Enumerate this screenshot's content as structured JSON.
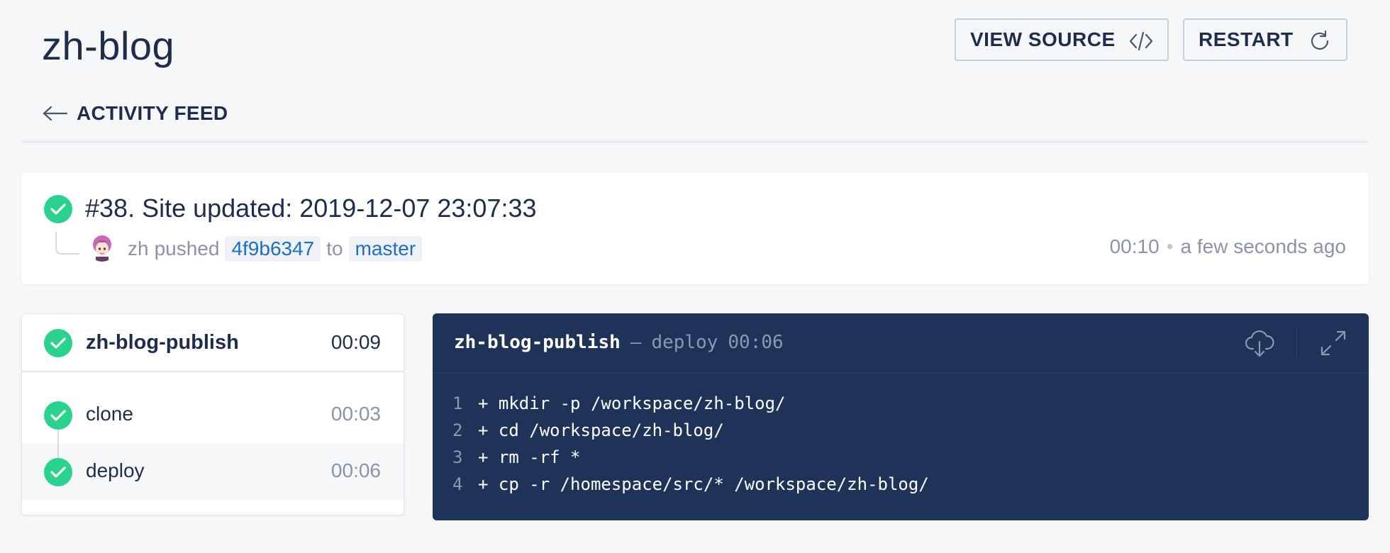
{
  "header": {
    "title": "zh-blog",
    "view_source_label": "VIEW SOURCE",
    "restart_label": "RESTART",
    "back_label": "ACTIVITY FEED"
  },
  "build": {
    "title": "#38. Site updated: 2019-12-07 23:07:33",
    "author": "zh",
    "pushed_text": "pushed",
    "commit": "4f9b6347",
    "to_text": "to",
    "branch": "master",
    "duration": "00:10",
    "separator": "•",
    "time_ago": "a few seconds ago",
    "status": "success"
  },
  "stage": {
    "name": "zh-blog-publish",
    "duration": "00:09",
    "steps": [
      {
        "name": "clone",
        "duration": "00:03"
      },
      {
        "name": "deploy",
        "duration": "00:06"
      }
    ]
  },
  "log": {
    "stage": "zh-blog-publish",
    "dash": "—",
    "step": "deploy",
    "duration": "00:06",
    "lines": [
      {
        "num": "1",
        "text": "+ mkdir -p /workspace/zh-blog/"
      },
      {
        "num": "2",
        "text": "+ cd /workspace/zh-blog/"
      },
      {
        "num": "3",
        "text": "+ rm -rf *"
      },
      {
        "num": "4",
        "text": "+ cp -r /homespace/src/* /workspace/zh-blog/"
      }
    ]
  },
  "icons": {
    "view_source": "code-icon",
    "restart": "refresh-icon",
    "back": "arrow-left-icon",
    "status": "check-circle-icon",
    "download": "cloud-download-icon",
    "expand": "expand-icon"
  },
  "colors": {
    "success": "#29d28f",
    "text": "#1f2d4d",
    "muted": "#8a94a6",
    "log_bg": "#1f3358",
    "link": "#1d6ec8"
  }
}
